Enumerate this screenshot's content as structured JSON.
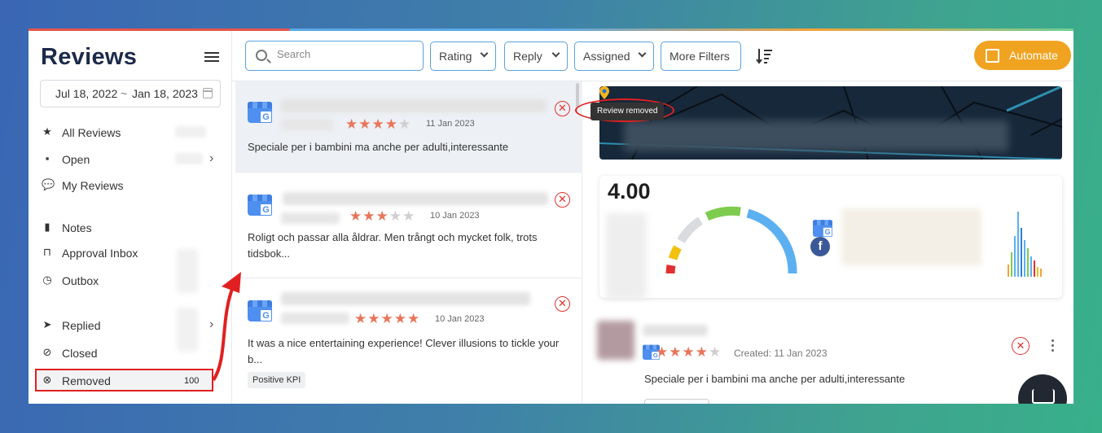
{
  "sidebar": {
    "title": "Reviews",
    "date_from": "Jul 18, 2022",
    "date_sep": "~",
    "date_to": "Jan 18, 2023",
    "items": [
      {
        "label": "All Reviews",
        "icon": "star-icon"
      },
      {
        "label": "Open",
        "icon": "archive-icon"
      },
      {
        "label": "My Reviews",
        "icon": "chat-bubble-icon"
      },
      {
        "label": "Notes",
        "icon": "note-icon"
      },
      {
        "label": "Approval Inbox",
        "icon": "inbox-icon"
      },
      {
        "label": "Outbox",
        "icon": "clock-icon"
      },
      {
        "label": "Replied",
        "icon": "send-icon"
      },
      {
        "label": "Closed",
        "icon": "check-circle-icon"
      },
      {
        "label": "Removed",
        "icon": "removed-circle-icon",
        "count": "100"
      }
    ]
  },
  "toolbar": {
    "search_placeholder": "Search",
    "filters": [
      "Rating",
      "Reply",
      "Assigned"
    ],
    "more_filters": "More Filters",
    "automate": "Automate"
  },
  "reviews": [
    {
      "rating": 4,
      "date": "11 Jan 2023",
      "text": "Speciale per i bambini ma anche per adulti,interessante"
    },
    {
      "rating": 3,
      "date": "10 Jan 2023",
      "text": "Roligt och passar alla åldrar. Men trångt och mycket folk, trots tidsbok..."
    },
    {
      "rating": 5,
      "date": "10 Jan 2023",
      "text": "It was a nice entertaining experience! Clever illusions to tickle your b...",
      "tag": "Positive KPI"
    }
  ],
  "detail": {
    "tooltip": "Review removed",
    "average": "4.00",
    "review": {
      "rating": 4,
      "created": "Created: 11 Jan 2023",
      "text": "Speciale per i bambini ma anche per adulti,interessante"
    }
  },
  "colors": {
    "accent": "#f0a321",
    "border_blue": "#5aa2dd",
    "removed_red": "#e0312f",
    "star": "#e8765a",
    "brand_dark": "#1c2a4a"
  }
}
